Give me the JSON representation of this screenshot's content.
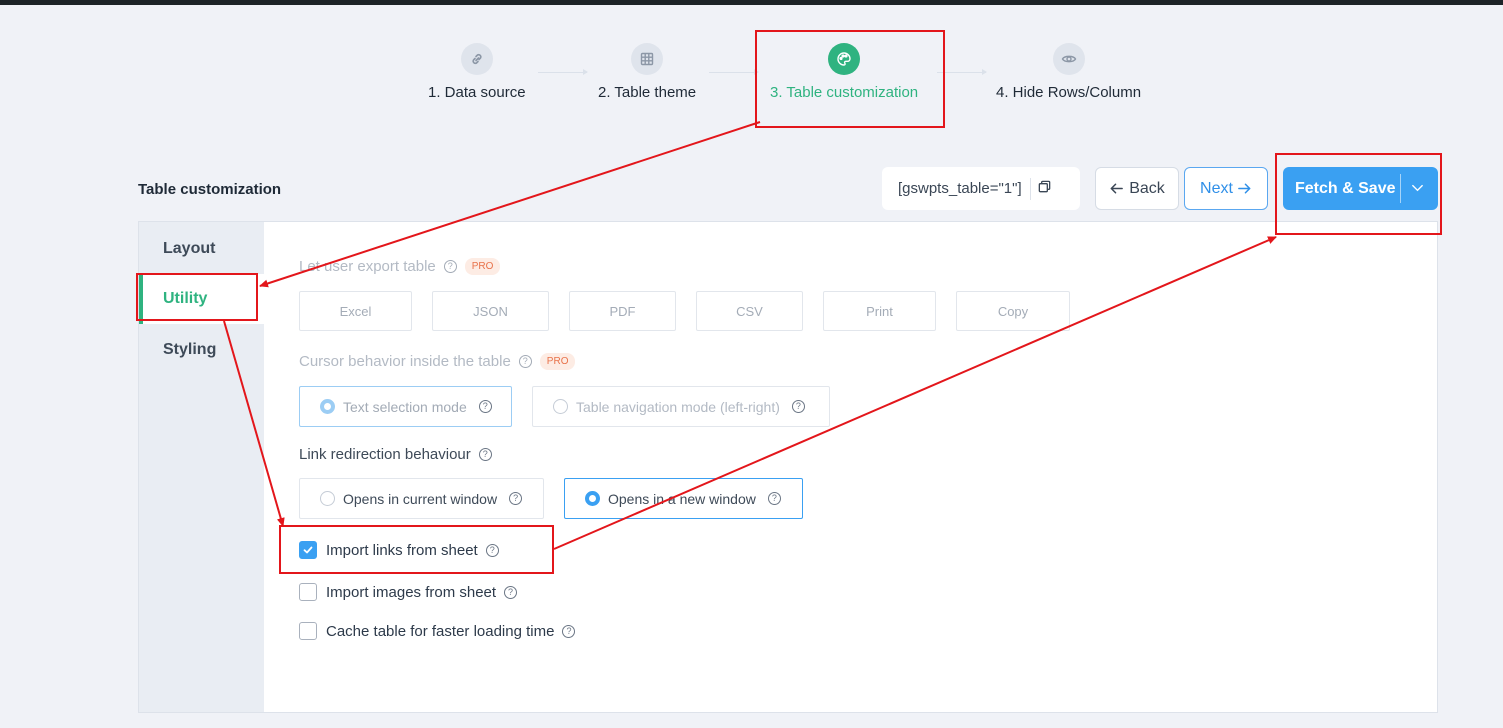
{
  "stepper": {
    "steps": [
      {
        "label": "1. Data source",
        "icon": "link-icon"
      },
      {
        "label": "2. Table theme",
        "icon": "grid-icon"
      },
      {
        "label": "3. Table customization",
        "icon": "palette-icon"
      },
      {
        "label": "4. Hide Rows/Column",
        "icon": "eye-icon"
      }
    ],
    "active_index": 2
  },
  "header": {
    "title": "Table customization",
    "shortcode": "[gswpts_table=\"1\"]",
    "back_label": "Back",
    "next_label": "Next",
    "fetch_save_label": "Fetch & Save"
  },
  "sidebar": {
    "items": [
      {
        "label": "Layout"
      },
      {
        "label": "Utility"
      },
      {
        "label": "Styling"
      }
    ],
    "active": "Utility"
  },
  "utility": {
    "export": {
      "label": "Let user export table",
      "badge": "PRO",
      "options": [
        "Excel",
        "JSON",
        "PDF",
        "CSV",
        "Print",
        "Copy"
      ]
    },
    "cursor": {
      "label": "Cursor behavior inside the table",
      "badge": "PRO",
      "options": [
        "Text selection mode",
        "Table navigation mode (left-right)"
      ],
      "selected": "Text selection mode"
    },
    "link_redirection": {
      "label": "Link redirection behaviour",
      "options": [
        "Opens in current window",
        "Opens in a new window"
      ],
      "selected": "Opens in a new window"
    },
    "checkboxes": [
      {
        "label": "Import links from sheet",
        "checked": true
      },
      {
        "label": "Import images from sheet",
        "checked": false
      },
      {
        "label": "Cache table for faster loading time",
        "checked": false
      }
    ]
  },
  "colors": {
    "accent_green": "#2fb380",
    "primary_blue": "#3aa0f2",
    "annotation_red": "#e3161b"
  }
}
